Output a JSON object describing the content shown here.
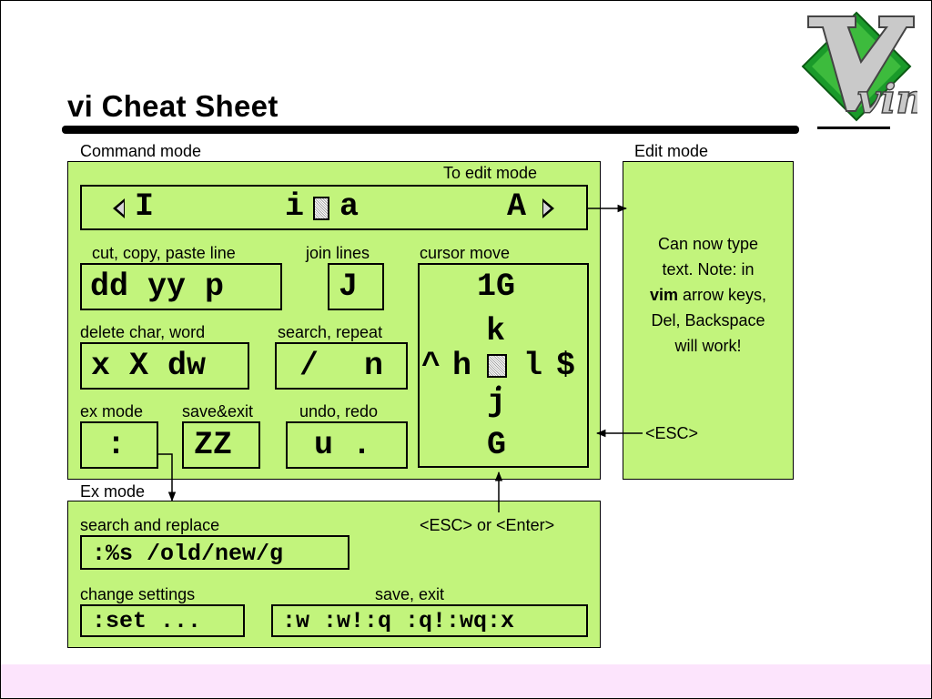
{
  "title": "vi Cheat Sheet",
  "logo": {
    "text": "vim",
    "icon": "vim-logo-icon"
  },
  "colors": {
    "panel": "#c2f47c",
    "footer": "#fce4fc"
  },
  "command_mode": {
    "label": "Command mode",
    "to_edit_label": "To edit mode",
    "insert_keys": {
      "I": "I",
      "i": "i",
      "a": "a",
      "A": "A"
    },
    "cut_copy_paste": {
      "label": "cut, copy, paste line",
      "value": "dd yy p"
    },
    "join": {
      "label": "join lines",
      "value": "J"
    },
    "delete": {
      "label": "delete char, word",
      "value": "x X dw"
    },
    "search": {
      "label": "search, repeat",
      "slash": "/",
      "n": "n"
    },
    "ex": {
      "label": "ex mode",
      "value": ":"
    },
    "save_exit": {
      "label": "save&exit",
      "value": "ZZ"
    },
    "undo_redo": {
      "label": "undo, redo",
      "value": "u ."
    },
    "cursor": {
      "label": "cursor move",
      "top": "1G",
      "k": "k",
      "caret": "^",
      "h": "h",
      "l": "l",
      "dollar": "$",
      "j": "j",
      "bottom": "G"
    }
  },
  "edit_mode": {
    "label": "Edit mode",
    "text": {
      "line1": "Can now type",
      "line2": "text. Note: in",
      "vim": "vim",
      "line3_rest": " arrow keys,",
      "line4": "Del, Backspace",
      "line5": "will work!"
    },
    "esc": "<ESC>"
  },
  "ex_mode": {
    "label": "Ex mode",
    "return_label": "<ESC> or <Enter>",
    "search_replace": {
      "label": "search and replace",
      "value": ":%s /old/new/g"
    },
    "settings": {
      "label": "change settings",
      "value": ":set ..."
    },
    "save_exit": {
      "label": "save, exit",
      "value": ":w :w!:q :q!:wq:x"
    }
  }
}
